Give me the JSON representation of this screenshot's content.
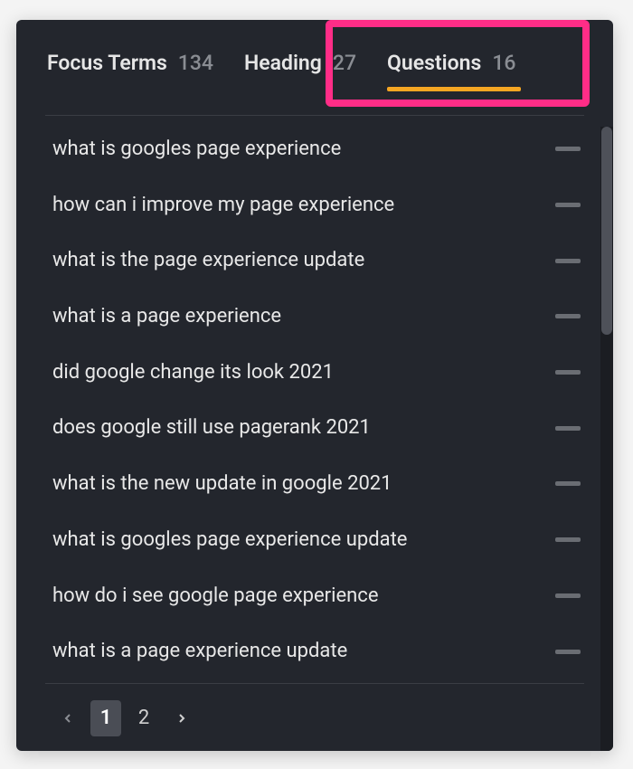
{
  "tabs": [
    {
      "label": "Focus Terms",
      "count": "134",
      "active": false
    },
    {
      "label": "Heading",
      "count": "27",
      "active": false
    },
    {
      "label": "Questions",
      "count": "16",
      "active": true
    }
  ],
  "questions": [
    "what is googles page experience",
    "how can i improve my page experience",
    "what is the page experience update",
    "what is a page experience",
    "did google change its look 2021",
    "does google still use pagerank 2021",
    "what is the new update in google 2021",
    "what is googles page experience update",
    "how do i see google page experience",
    "what is a page experience update"
  ],
  "pagination": {
    "pages": [
      "1",
      "2"
    ],
    "current": "1"
  },
  "colors": {
    "accent": "#f5a623",
    "highlight": "#ff2d87"
  }
}
